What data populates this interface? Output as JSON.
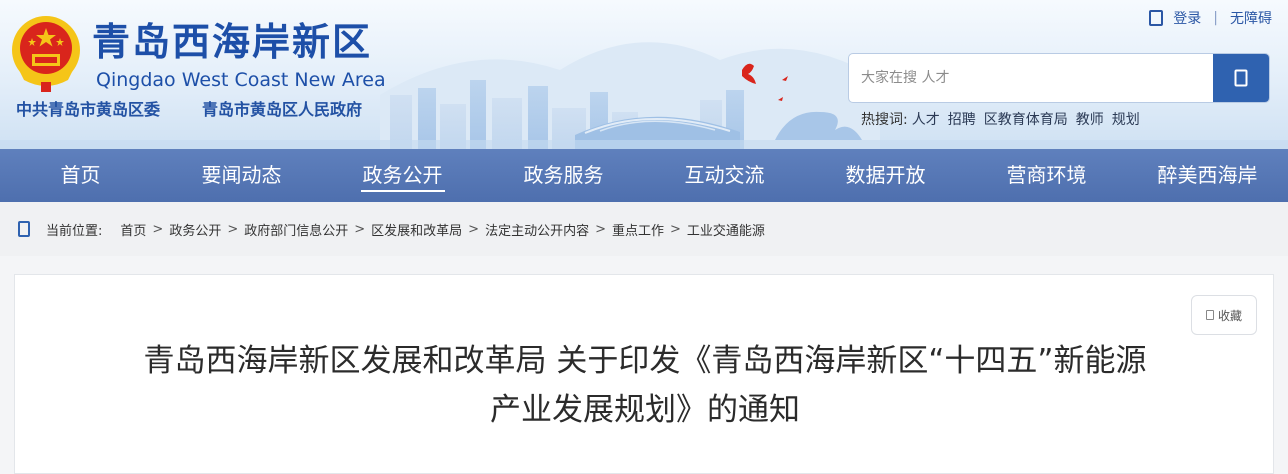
{
  "header": {
    "site_title": "青岛西海岸新区",
    "site_title_en": "Qingdao West Coast New Area",
    "org_party": "中共青岛市黄岛区委",
    "org_government": "青岛市黄岛区人民政府",
    "emblem_icon": "national-emblem-icon"
  },
  "top_links": {
    "login": "登录",
    "separator": "|",
    "accessibility": "无障碍",
    "user_icon": "user-icon"
  },
  "search": {
    "placeholder": "大家在搜 人才",
    "button_icon": "search-icon",
    "hot_label": "热搜词:",
    "hot_words": [
      "人才",
      "招聘",
      "区教育体育局",
      "教师",
      "规划"
    ]
  },
  "nav": {
    "items": [
      "首页",
      "要闻动态",
      "政务公开",
      "政务服务",
      "互动交流",
      "数据开放",
      "营商环境",
      "醉美西海岸"
    ],
    "active_index": 2
  },
  "breadcrumb": {
    "label": "当前位置:",
    "separator": ">",
    "items": [
      "首页",
      "政务公开",
      "政府部门信息公开",
      "区发展和改革局",
      "法定主动公开内容",
      "重点工作",
      "工业交通能源"
    ]
  },
  "article": {
    "favorite_label": "收藏",
    "title_line1": "青岛西海岸新区发展和改革局 关于印发《青岛西海岸新区“十四五”新能源",
    "title_line2": "产业发展规划》的通知"
  },
  "colors": {
    "brand_blue": "#1d4fa8",
    "nav_blue": "#5677b6",
    "search_button": "#2f62b0",
    "emblem_red": "#d9251c",
    "emblem_gold": "#f5c518"
  }
}
